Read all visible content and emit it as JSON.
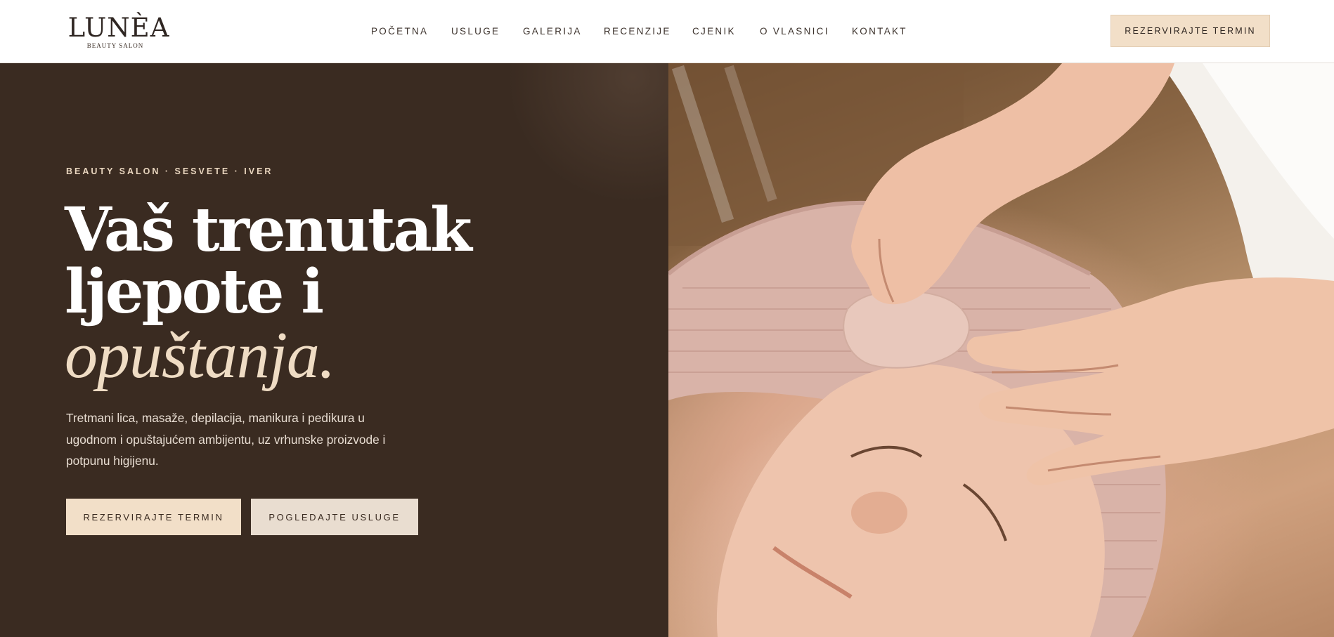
{
  "brand": {
    "name": "LUNÈA",
    "tagline": "BEAUTY SALON"
  },
  "nav": {
    "items": [
      {
        "label": "POČETNA"
      },
      {
        "label": "USLUGE"
      },
      {
        "label": "GALERIJA"
      },
      {
        "label": "RECENZIJE"
      },
      {
        "label": "CJENIK"
      },
      {
        "label": "O VLASNICI"
      },
      {
        "label": "KONTAKT"
      }
    ],
    "cta_label": "REZERVIRAJTE TERMIN"
  },
  "hero": {
    "eyebrow": "BEAUTY SALON · SESVETE · IVER",
    "headline_line1": "Vaš trenutak",
    "headline_line2": "ljepote i",
    "headline_accent": "opuštanja.",
    "lead": "Tretmani lica, masaže, depilacija, manikura i pedikura u ugodnom i opuštajućem ambijentu, uz vrhunske proizvode i potpunu higijenu.",
    "primary_cta": "REZERVIRAJTE TERMIN",
    "secondary_cta": "POGLEDAJTE USLUGE"
  },
  "colors": {
    "hero_background": "#3a2b21",
    "accent_cream": "#f2dfc8",
    "headline_accent": "#efdcc4",
    "text_dark": "#3c322c"
  },
  "image": {
    "subject": "facial-treatment-photo"
  }
}
